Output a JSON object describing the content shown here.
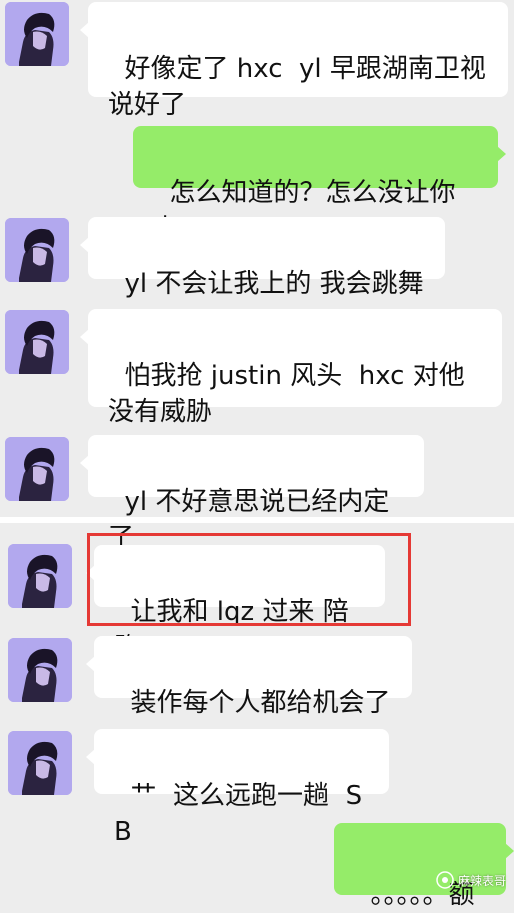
{
  "colors": {
    "background": "#ededed",
    "incoming_bubble": "#ffffff",
    "outgoing_bubble": "#95ec69",
    "avatar_bg": "#b2a8ee",
    "highlight_border": "#e53935"
  },
  "messages": [
    {
      "side": "incoming",
      "text": "好像定了 hxc  yl 早跟湖南卫视说好了"
    },
    {
      "side": "outgoing",
      "text": "怎么知道的？怎么没让你上"
    },
    {
      "side": "incoming",
      "text": "yl 不会让我上的 我会跳舞"
    },
    {
      "side": "incoming",
      "text": "怕我抢 justin 风头  hxc 对他没有威胁"
    },
    {
      "side": "incoming",
      "text": "yl 不好意思说已经内定了"
    },
    {
      "side": "incoming",
      "text": "让我和 lqz 过来 陪跑",
      "highlighted": true
    },
    {
      "side": "incoming",
      "text": "装作每个人都给机会了"
    },
    {
      "side": "incoming",
      "text": "艹  这么远跑一趟  SB"
    },
    {
      "side": "outgoing",
      "text": "。。。。。额"
    }
  ],
  "watermark": {
    "text": "麻辣表哥",
    "icon": "wechat-official-account-icon"
  }
}
